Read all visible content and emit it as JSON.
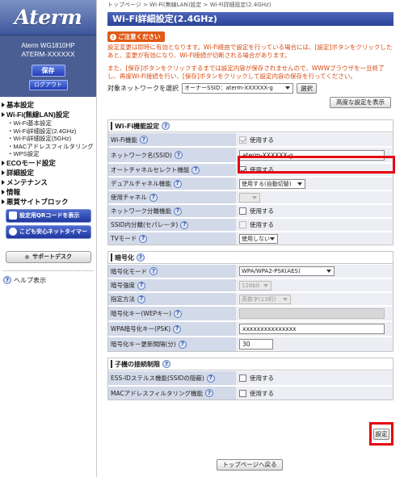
{
  "sidebar": {
    "logo": "Aterm",
    "model_name": "Aterm WG1810HP",
    "device_ssid": "ATERM-XXXXXX",
    "save_label": "保存",
    "logout_label": "ログアウト",
    "nav": [
      {
        "label": "基本設定"
      },
      {
        "label": "Wi-Fi(無線LAN)設定"
      },
      {
        "label": "ECOモード設定"
      },
      {
        "label": "詳細設定"
      },
      {
        "label": "メンテナンス"
      },
      {
        "label": "情報"
      },
      {
        "label": "悪質サイトブロック"
      }
    ],
    "wifi_sub": [
      "・Wi-Fi基本設定",
      "・Wi-Fi詳細設定(2.4GHz)",
      "・Wi-Fi詳細設定(5GHz)",
      "・MACアドレスフィルタリング",
      "・WPS設定"
    ],
    "qr_button": "設定用QRコードを表示",
    "kids_button": "こども安心ネットタイマー",
    "support_button": "サポートデスク",
    "help_label": "ヘルプ表示"
  },
  "breadcrumb": "トップページ > Wi-Fi(無線LAN)設定 > Wi-Fi詳細設定(2.4GHz)",
  "page_title": "Wi-Fi詳細設定(2.4GHz)",
  "notice": {
    "heading": "ご注意ください",
    "text1": "設定変更は即時に有効となります。Wi-Fi経由で設定を行っている場合には、[設定]ボタンをクリックしたあと、変更が有効になり、Wi-Fi接続が切断される場合があります。",
    "text2": "また、[保存]ボタンをクリックするまでは設定内容が保存されませんので、WWWブラウザを一旦終了し、再度Wi-Fi接続を行い、[保存]ボタンをクリックして設定内容の保存を行ってください。"
  },
  "target_network": {
    "label": "対象ネットワークを選択",
    "value": "オーナーSSID：aterm-XXXXXX-g",
    "select_button": "選択"
  },
  "advanced_button": "高度な設定を表示",
  "wifi_section": {
    "title": "Wi-Fi機能設定",
    "rows": {
      "wifi_function": {
        "label": "Wi-Fi機能",
        "value": "使用する"
      },
      "ssid": {
        "label": "ネットワーク名(SSID)",
        "value": "aterm-XXXXXX-g"
      },
      "auto_channel": {
        "label": "オートチャネルセレクト機能",
        "value": "使用する"
      },
      "dual_channel": {
        "label": "デュアルチャネル機能",
        "value": "使用する(自動切替)"
      },
      "channel": {
        "label": "使用チャネル",
        "value": ""
      },
      "separation": {
        "label": "ネットワーク分離機能",
        "value": "使用する"
      },
      "ssid_separator": {
        "label": "SSID内分離(セパレータ)",
        "value": "使用する"
      },
      "tv_mode": {
        "label": "TVモード",
        "value": "使用しない"
      }
    }
  },
  "encryption_section": {
    "title": "暗号化",
    "rows": {
      "mode": {
        "label": "暗号化モード",
        "value": "WPA/WPA2-PSK(AES)"
      },
      "strength": {
        "label": "暗号強度",
        "value": "128bit"
      },
      "method": {
        "label": "指定方法",
        "value": "英数字(13桁)"
      },
      "wep_key": {
        "label": "暗号化キー(WEPキー)",
        "value": ""
      },
      "psk": {
        "label": "WPA暗号化キー(PSK)",
        "value": "xxxxxxxxxxxxxxx"
      },
      "interval": {
        "label": "暗号化キー更新間隔(分)",
        "value": "30"
      }
    }
  },
  "client_section": {
    "title": "子機の接続制限",
    "rows": {
      "stealth": {
        "label": "ESS-IDステルス機能(SSIDの隠蔽)",
        "value": "使用する"
      },
      "mac_filter": {
        "label": "MACアドレスフィルタリング機能",
        "value": "使用する"
      }
    }
  },
  "set_button": "設定",
  "back_button": "トップページへ戻る",
  "colors": {
    "title_bar": "#3a53a8",
    "label_bg": "#d2d9e8",
    "notice": "#d84a10",
    "highlight": "#e60012"
  }
}
